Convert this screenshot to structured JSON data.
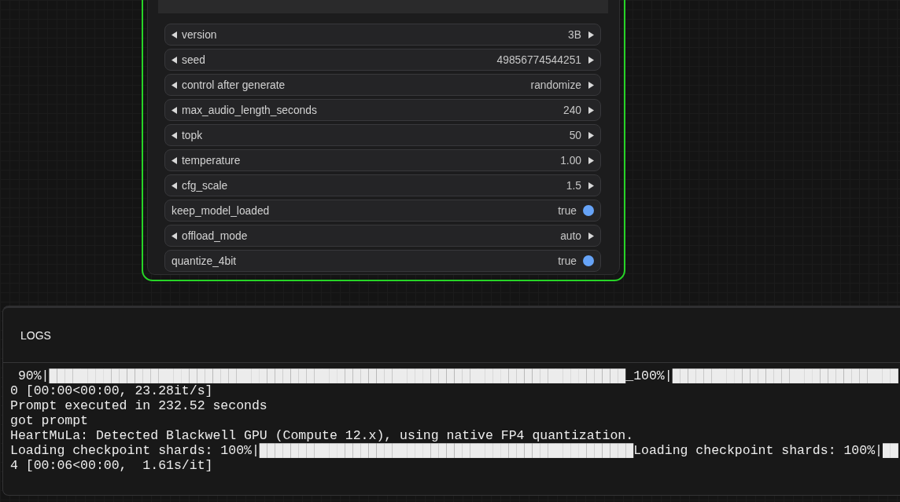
{
  "node": {
    "executing": true,
    "widgets": [
      {
        "kind": "textarea"
      },
      {
        "kind": "stepper",
        "label": "version",
        "value": "3B"
      },
      {
        "kind": "stepper",
        "label": "seed",
        "value": "49856774544251"
      },
      {
        "kind": "stepper",
        "label": "control after generate",
        "value": "randomize"
      },
      {
        "kind": "stepper",
        "label": "max_audio_length_seconds",
        "value": "240"
      },
      {
        "kind": "stepper",
        "label": "topk",
        "value": "50"
      },
      {
        "kind": "stepper",
        "label": "temperature",
        "value": "1.00"
      },
      {
        "kind": "stepper",
        "label": "cfg_scale",
        "value": "1.5"
      },
      {
        "kind": "toggle",
        "label": "keep_model_loaded",
        "value": "true",
        "on": true
      },
      {
        "kind": "stepper",
        "label": "offload_mode",
        "value": "auto"
      },
      {
        "kind": "toggle",
        "label": "quantize_4bit",
        "value": "true",
        "on": true
      }
    ]
  },
  "logs": {
    "title": "LOGS",
    "lines": [
      " 90%|██████████████████████████████████████████████████████████████████████████_100%|█████████████████████████████",
      "0 [00:00<00:00, 23.28it/s]",
      "Prompt executed in 232.52 seconds",
      "got prompt",
      "HeartMuLa: Detected Blackwell GPU (Compute 12.x), using native FP4 quantization.",
      "Loading checkpoint shards: 100%|████████████████████████████████████████████████Loading checkpoint shards: 100%|██",
      "4 [00:06<00:00,  1.61s/it]"
    ]
  }
}
